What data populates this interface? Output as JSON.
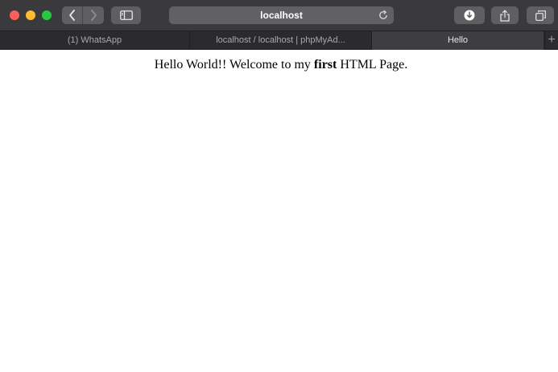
{
  "browser": {
    "address": "localhost",
    "tabs": [
      {
        "label": "(1) WhatsApp"
      },
      {
        "label": "localhost / localhost | phpMyAd..."
      },
      {
        "label": "Hello"
      }
    ],
    "new_tab_label": "+"
  },
  "icons": {
    "back": "chevron-left-icon",
    "forward": "chevron-right-icon",
    "sidebar": "sidebar-icon",
    "reload": "reload-icon",
    "download": "download-icon",
    "share": "share-icon",
    "tabs": "tab-overview-icon"
  },
  "colors": {
    "toolbar": "#3a3a3c",
    "close": "#ff5f57",
    "minimize": "#febc2e",
    "zoom": "#28c840"
  },
  "page": {
    "text_before": "Hello World!! Welcome to my ",
    "bold_text": "first",
    "text_after": " HTML Page."
  }
}
